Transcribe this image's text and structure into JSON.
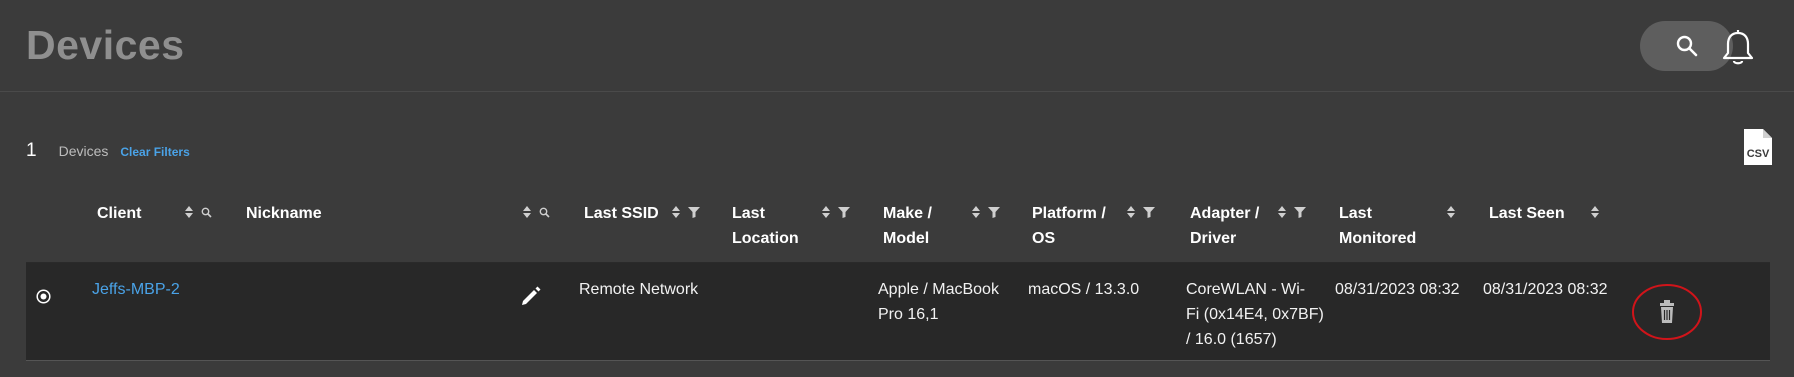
{
  "header": {
    "title": "Devices",
    "search_icon": "search-icon",
    "bell_icon": "bell-icon"
  },
  "summary": {
    "count": "1",
    "label": "Devices",
    "clear_filters": "Clear Filters",
    "csv_icon": "csv-file-icon",
    "csv_label": "CSV"
  },
  "table": {
    "columns": [
      {
        "label": "Client",
        "line2": ""
      },
      {
        "label": "Nickname",
        "line2": ""
      },
      {
        "label": "Last SSID",
        "line2": ""
      },
      {
        "label": "Last",
        "line2": "Location"
      },
      {
        "label": "Make /",
        "line2": "Model"
      },
      {
        "label": "Platform /",
        "line2": "OS"
      },
      {
        "label": "Adapter /",
        "line2": "Driver"
      },
      {
        "label": "Last",
        "line2": "Monitored"
      },
      {
        "label": "Last Seen",
        "line2": ""
      }
    ],
    "rows": [
      {
        "client": "Jeffs-MBP-2",
        "nickname": "",
        "last_ssid": "Remote Network",
        "last_location": "",
        "make_model_1": "Apple / MacBook",
        "make_model_2": "Pro 16,1",
        "platform_os": "macOS / 13.3.0",
        "adapter_1": "CoreWLAN - Wi-",
        "adapter_2": "Fi (0x14E4, 0x7BF)",
        "adapter_3": "/ 16.0 (1657)",
        "last_monitored": "08/31/2023 08:32",
        "last_seen": "08/31/2023 08:32"
      }
    ]
  },
  "colors": {
    "background": "#3b3b3b",
    "row_background": "#282828",
    "link": "#4aa3e8",
    "title": "#8f8f8f",
    "highlight_circle": "#d0141a"
  }
}
